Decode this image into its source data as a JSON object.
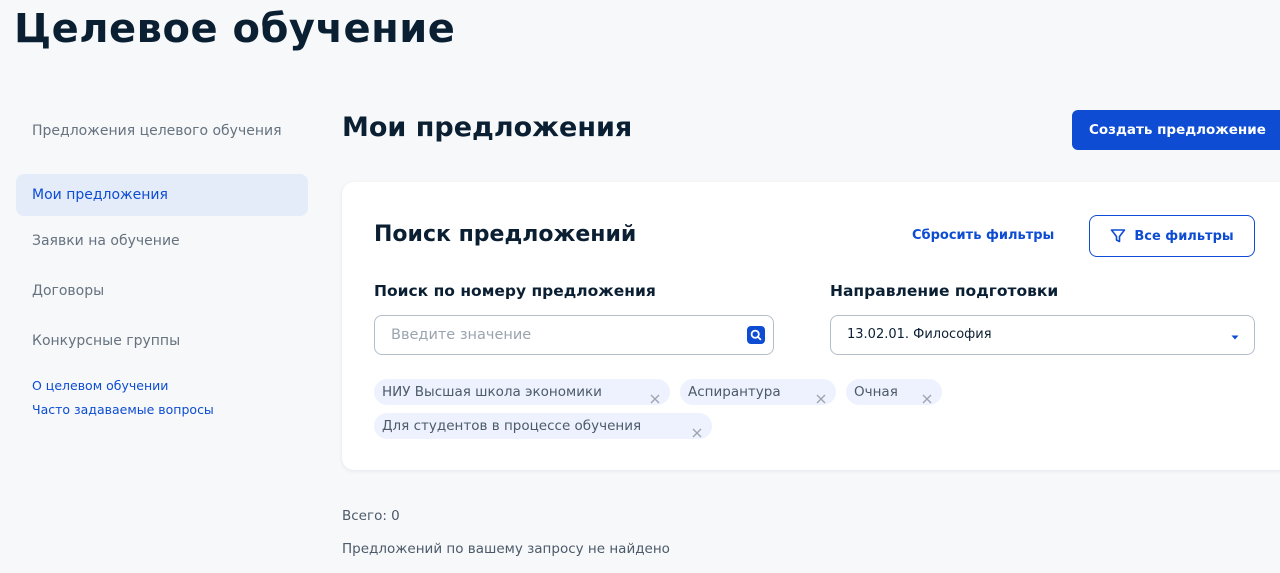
{
  "header": {
    "title": "Целевое обучение"
  },
  "sidebar": {
    "items": [
      {
        "label": "Предложения целевого обучения"
      },
      {
        "label": "Мои предложения",
        "active": true
      },
      {
        "label": "Заявки на обучение"
      },
      {
        "label": "Договоры"
      },
      {
        "label": "Конкурсные группы"
      }
    ],
    "links": [
      {
        "label": "О целевом обучении"
      },
      {
        "label": "Часто задаваемые вопросы"
      }
    ]
  },
  "main": {
    "title": "Мои предложения",
    "create_button": "Создать предложение",
    "search": {
      "title": "Поиск предложений",
      "reset_link": "Сбросить фильтры",
      "all_filters_button": "Все фильтры",
      "number_label": "Поиск по номеру предложения",
      "number_placeholder": "Введите значение",
      "number_value": "",
      "direction_label": "Направление подготовки",
      "direction_value": "13.02.01. Философия",
      "chips": [
        "НИУ Высшая школа экономики",
        "Аспирантура",
        "Очная",
        "Для студентов в процессе обучения"
      ]
    },
    "total": "Всего: 0",
    "empty_message": "Предложений по вашему запросу не найдено"
  },
  "colors": {
    "accent": "#0d4cd3",
    "text": "#0b1f33",
    "muted": "#66727f",
    "active_bg": "#e4ecfa",
    "chip_bg": "#edf2fe"
  },
  "icons": {
    "search": "search-icon",
    "filter": "filter-icon",
    "dropdown": "chevron-down-icon",
    "chip_remove": "close-icon"
  }
}
